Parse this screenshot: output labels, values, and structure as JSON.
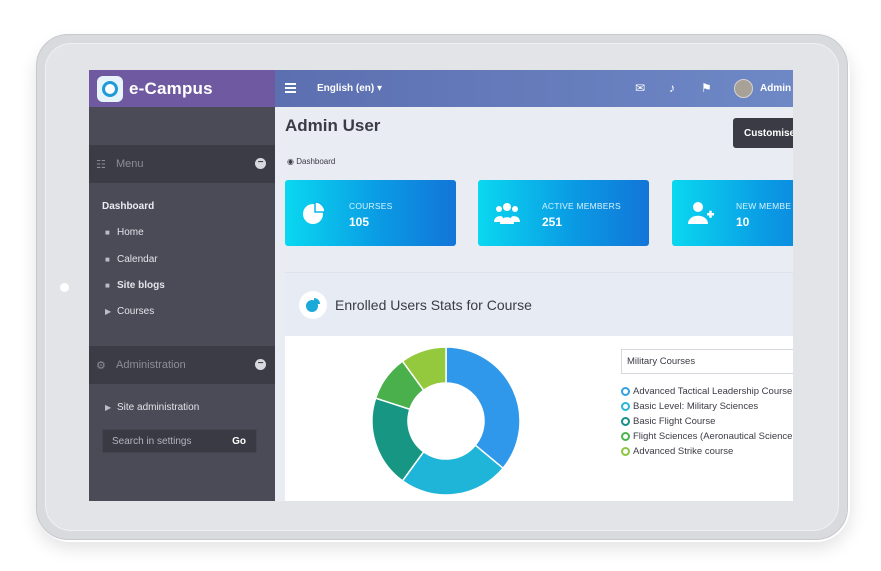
{
  "app": {
    "brand_name": "e-Campus"
  },
  "topbar": {
    "language": "English (en) ▾",
    "user_name": "Admin"
  },
  "sidebar": {
    "menu_heading": "Menu",
    "section_title": "Dashboard",
    "items": [
      {
        "label": "Home"
      },
      {
        "label": "Calendar"
      },
      {
        "label": "Site blogs"
      },
      {
        "label": "Courses"
      }
    ],
    "admin_heading": "Administration",
    "admin_item": "Site administration",
    "search_placeholder": "Search in settings",
    "search_go": "Go"
  },
  "main": {
    "title": "Admin User",
    "customise_label": "Customise",
    "breadcrumb": "Dashboard",
    "stats": [
      {
        "label": "COURSES",
        "value": "105",
        "icon": "pie-chart-icon"
      },
      {
        "label": "ACTIVE MEMBERS",
        "value": "251",
        "icon": "users-icon"
      },
      {
        "label": "NEW MEMBE",
        "value": "10",
        "icon": "add-user-icon"
      }
    ],
    "panel": {
      "title": "Enrolled Users Stats for Course",
      "select_value": "Military Courses",
      "legend": [
        {
          "label": "Advanced Tactical Leadership Course",
          "color": "#33a1e0"
        },
        {
          "label": "Basic Level: Military Sciences",
          "color": "#29b6d6"
        },
        {
          "label": "Basic Flight Course",
          "color": "#178f86"
        },
        {
          "label": "Flight Sciences (Aeronautical Science",
          "color": "#4ab54a"
        },
        {
          "label": "Advanced Strike course",
          "color": "#8cc63f"
        }
      ]
    }
  },
  "chart_data": {
    "type": "pie",
    "donut": true,
    "categories": [
      "Advanced Tactical Leadership Course",
      "Basic Level: Military Sciences",
      "Basic Flight Course",
      "Flight Sciences (Aeronautical Science",
      "Advanced Strike course"
    ],
    "values": [
      36,
      24,
      20,
      10,
      10
    ],
    "colors": [
      "#2f98ea",
      "#1fb5d8",
      "#169683",
      "#49b04b",
      "#94c93d"
    ]
  }
}
